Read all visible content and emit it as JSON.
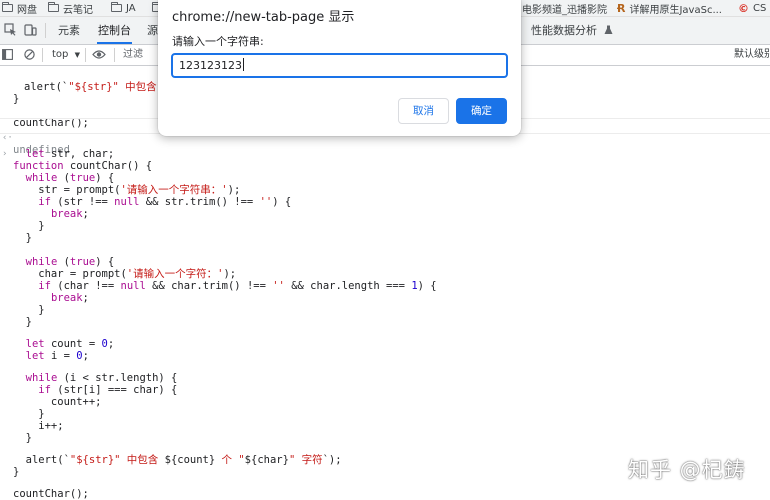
{
  "bookmarks": {
    "items": [
      "网盘",
      "云笔记",
      "JA",
      "电影频道_迅播影院",
      "详解用原生JavaSc...",
      "CS"
    ]
  },
  "devtools": {
    "tabs": [
      "元素",
      "控制台",
      "源",
      "性能数据分析"
    ],
    "active_tab": "控制台"
  },
  "toolbar": {
    "context": "top",
    "filter_placeholder": "过滤",
    "levels": "默认级别"
  },
  "console": {
    "prev_lines": [
      "alert(`\"${str}\" 中包含 $",
      "}",
      "",
      "countChar();",
      "undefined"
    ],
    "code_lines": [
      "function countChar() {",
      "  let str, char;",
      "",
      "  while (true) {",
      "    str = prompt('请输入一个字符串：');",
      "    if (str !== null && str.trim() !== '') {",
      "      break;",
      "    }",
      "  }",
      "",
      "  while (true) {",
      "    char = prompt('请输入一个字符：');",
      "    if (char !== null && char.trim() !== '' && char.length === 1) {",
      "      break;",
      "    }",
      "  }",
      "",
      "  let count = 0;",
      "  let i = 0;",
      "",
      "  while (i < str.length) {",
      "    if (str[i] === char) {",
      "      count++;",
      "    }",
      "    i++;",
      "  }",
      "",
      "  alert(`\"${str}\" 中包含 ${count} 个 \"${char}\" 字符`);",
      "}",
      "",
      "countChar();"
    ]
  },
  "dialog": {
    "title": "chrome://new-tab-page 显示",
    "message": "请输入一个字符串:",
    "input_value": "123123123",
    "cancel_label": "取消",
    "ok_label": "确定"
  },
  "watermark": "知乎 @杞鋳",
  "colors": {
    "accent": "#1a73e8",
    "keyword": "#aa0d91",
    "string": "#c41a16",
    "number": "#1c00cf"
  }
}
